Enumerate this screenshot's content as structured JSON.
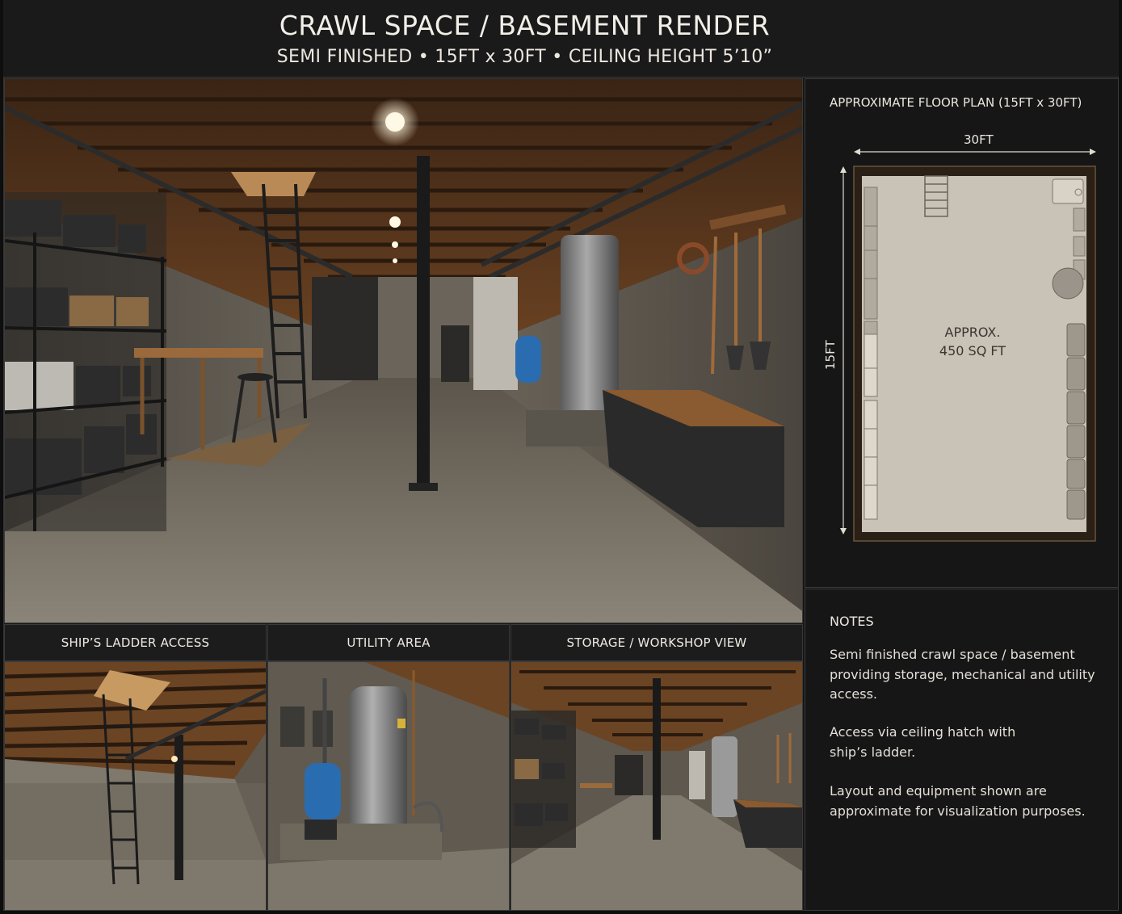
{
  "header": {
    "title": "CRAWL SPACE / BASEMENT RENDER",
    "subtitle": "SEMI FINISHED  •  15FT x 30FT  •  CEILING HEIGHT 5’10”"
  },
  "captions": {
    "ladder": "SHIP’S LADDER ACCESS",
    "utility": "UTILITY AREA",
    "storage": "STORAGE / WORKSHOP VIEW"
  },
  "floor_plan": {
    "title": "APPROXIMATE FLOOR PLAN (15FT x 30FT)",
    "width_label": "30FT",
    "depth_label": "15FT",
    "area_line1": "APPROX.",
    "area_line2": "450 SQ FT"
  },
  "notes": {
    "heading": "NOTES",
    "items": [
      "Semi finished crawl space / basement providing storage, mechanical and utility access.",
      "Access via ceiling hatch with ship’s ladder.",
      "Layout and equipment shown are approximate for visualization purposes."
    ]
  },
  "colors": {
    "background": "#161616",
    "wood": "#8a5a30",
    "concrete": "#7e776c",
    "floor_plan_fill": "#c9c2b6",
    "floor_plan_border": "#2a2016",
    "tank_blue": "#2a6cb0"
  }
}
